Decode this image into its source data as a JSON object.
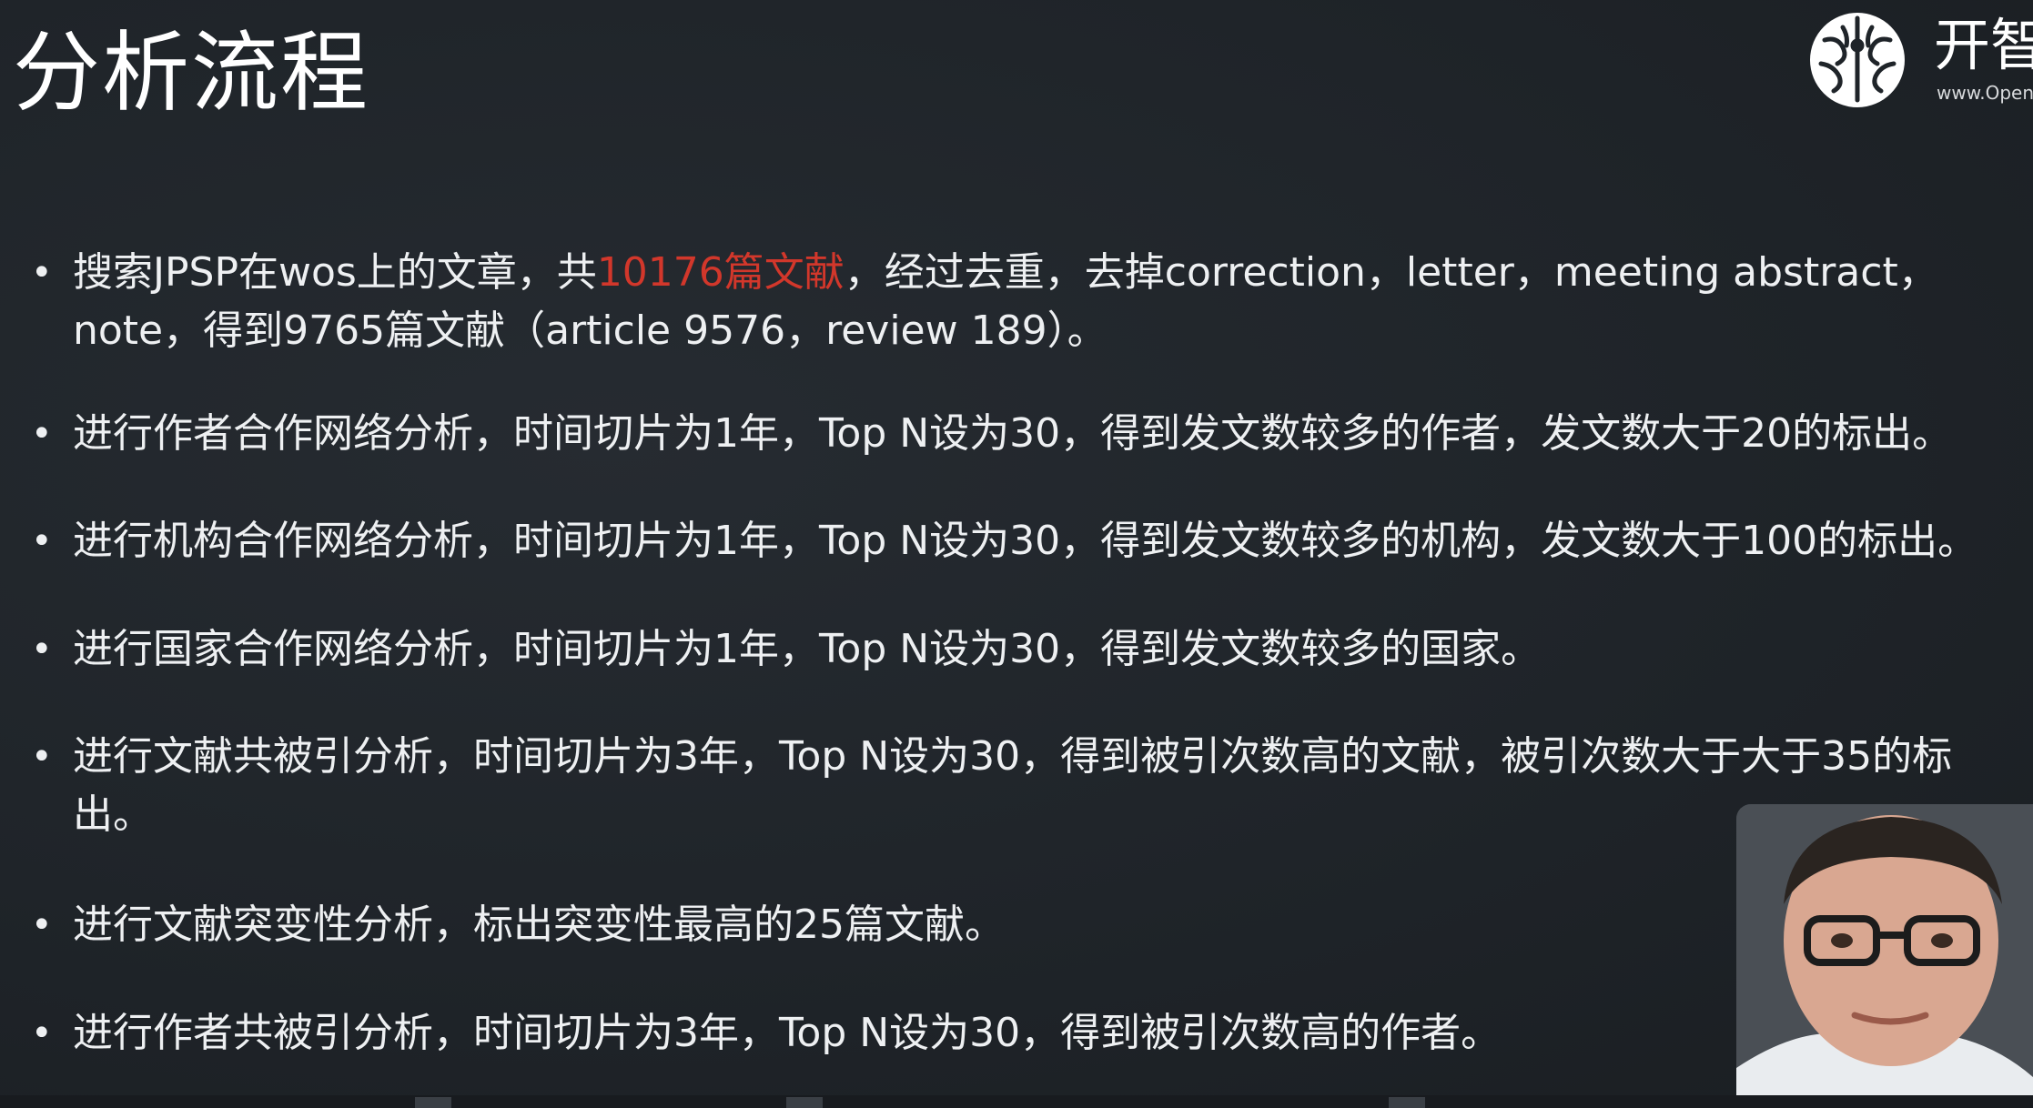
{
  "slide": {
    "title": "分析流程"
  },
  "logo": {
    "name": "开智",
    "url": "www.Open"
  },
  "bullets": [
    {
      "marker": "•",
      "before": "搜索JPSP在wos上的文章，共",
      "highlight": "10176篇文献",
      "after": "，经过去重，去掉correction，letter，meeting abstract，note，得到9765篇文献（article 9576，review 189）。"
    },
    {
      "marker": "•",
      "text": "进行作者合作网络分析，时间切片为1年，Top N设为30，得到发文数较多的作者，发文数大于20的标出。"
    },
    {
      "marker": "•",
      "text": "进行机构合作网络分析，时间切片为1年，Top N设为30，得到发文数较多的机构，发文数大于100的标出。"
    },
    {
      "marker": "•",
      "text": "进行国家合作网络分析，时间切片为1年，Top N设为30，得到发文数较多的国家。"
    },
    {
      "marker": "•",
      "text": "进行文献共被引分析，时间切片为3年，Top N设为30，得到被引次数高的文献，被引次数大于大于35的标出。"
    },
    {
      "marker": "•",
      "text": "进行文献突变性分析，标出突变性最高的25篇文献。"
    },
    {
      "marker": "•",
      "text": "进行作者共被引分析，时间切片为3年，Top N设为30，得到被引次数高的作者。"
    }
  ],
  "colors": {
    "background": "#1f2429",
    "text": "#eef0f2",
    "highlight": "#d2372b"
  }
}
